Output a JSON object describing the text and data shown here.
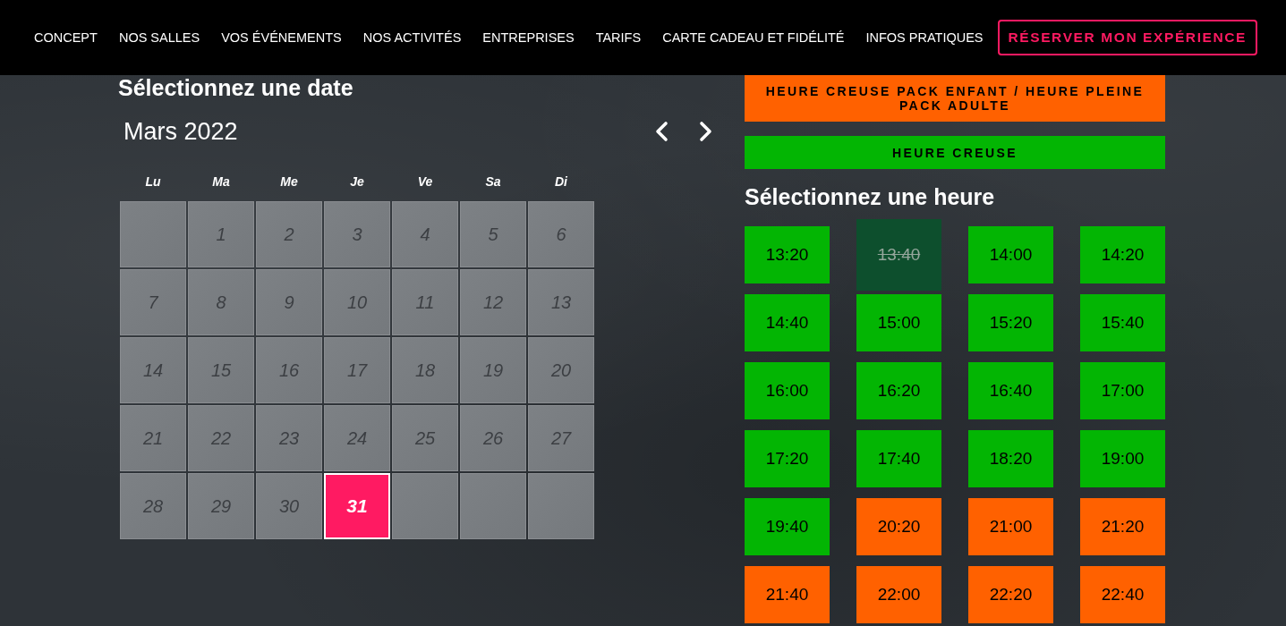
{
  "nav": {
    "links": [
      "CONCEPT",
      "NOS SALLES",
      "VOS ÉVÉNEMENTS",
      "NOS ACTIVITÉS",
      "ENTREPRISES",
      "TARIFS",
      "CARTE CADEAU ET FIDÉLITÉ",
      "INFOS PRATIQUES"
    ],
    "reserve_button": "RÉSERVER MON EXPÉRIENCE"
  },
  "date_picker": {
    "title": "Sélectionnez une date",
    "month": "Mars 2022",
    "weekdays": [
      "Lu",
      "Ma",
      "Me",
      "Je",
      "Ve",
      "Sa",
      "Di"
    ],
    "cells": [
      {
        "kind": "empty"
      },
      {
        "kind": "day",
        "label": "1",
        "disabled": true,
        "selected": false
      },
      {
        "kind": "day",
        "label": "2",
        "disabled": true,
        "selected": false
      },
      {
        "kind": "day",
        "label": "3",
        "disabled": true,
        "selected": false
      },
      {
        "kind": "day",
        "label": "4",
        "disabled": true,
        "selected": false
      },
      {
        "kind": "day",
        "label": "5",
        "disabled": true,
        "selected": false
      },
      {
        "kind": "day",
        "label": "6",
        "disabled": true,
        "selected": false
      },
      {
        "kind": "day",
        "label": "7",
        "disabled": true,
        "selected": false
      },
      {
        "kind": "day",
        "label": "8",
        "disabled": true,
        "selected": false
      },
      {
        "kind": "day",
        "label": "9",
        "disabled": true,
        "selected": false
      },
      {
        "kind": "day",
        "label": "10",
        "disabled": true,
        "selected": false
      },
      {
        "kind": "day",
        "label": "11",
        "disabled": true,
        "selected": false
      },
      {
        "kind": "day",
        "label": "12",
        "disabled": true,
        "selected": false
      },
      {
        "kind": "day",
        "label": "13",
        "disabled": true,
        "selected": false
      },
      {
        "kind": "day",
        "label": "14",
        "disabled": true,
        "selected": false
      },
      {
        "kind": "day",
        "label": "15",
        "disabled": true,
        "selected": false
      },
      {
        "kind": "day",
        "label": "16",
        "disabled": true,
        "selected": false
      },
      {
        "kind": "day",
        "label": "17",
        "disabled": true,
        "selected": false
      },
      {
        "kind": "day",
        "label": "18",
        "disabled": true,
        "selected": false
      },
      {
        "kind": "day",
        "label": "19",
        "disabled": true,
        "selected": false
      },
      {
        "kind": "day",
        "label": "20",
        "disabled": true,
        "selected": false
      },
      {
        "kind": "day",
        "label": "21",
        "disabled": true,
        "selected": false
      },
      {
        "kind": "day",
        "label": "22",
        "disabled": true,
        "selected": false
      },
      {
        "kind": "day",
        "label": "23",
        "disabled": true,
        "selected": false
      },
      {
        "kind": "day",
        "label": "24",
        "disabled": true,
        "selected": false
      },
      {
        "kind": "day",
        "label": "25",
        "disabled": true,
        "selected": false
      },
      {
        "kind": "day",
        "label": "26",
        "disabled": true,
        "selected": false
      },
      {
        "kind": "day",
        "label": "27",
        "disabled": true,
        "selected": false
      },
      {
        "kind": "day",
        "label": "28",
        "disabled": true,
        "selected": false
      },
      {
        "kind": "day",
        "label": "29",
        "disabled": true,
        "selected": false
      },
      {
        "kind": "day",
        "label": "30",
        "disabled": true,
        "selected": false
      },
      {
        "kind": "day",
        "label": "31",
        "disabled": false,
        "selected": true
      },
      {
        "kind": "empty"
      },
      {
        "kind": "empty"
      },
      {
        "kind": "empty"
      }
    ]
  },
  "legend": [
    {
      "label": "HEURE CREUSE PACK ENFANT / HEURE PLEINE PACK ADULTE",
      "color": "#ff6100"
    },
    {
      "label": "HEURE CREUSE",
      "color": "#03b503"
    }
  ],
  "time_picker": {
    "title": "Sélectionnez une heure",
    "slots": [
      {
        "time": "13:20",
        "color": "#03b503",
        "disabled": false
      },
      {
        "time": "13:40",
        "color": "#0d4f2d",
        "disabled": true
      },
      {
        "time": "14:00",
        "color": "#03b503",
        "disabled": false
      },
      {
        "time": "14:20",
        "color": "#03b503",
        "disabled": false
      },
      {
        "time": "14:40",
        "color": "#03b503",
        "disabled": false
      },
      {
        "time": "15:00",
        "color": "#03b503",
        "disabled": false
      },
      {
        "time": "15:20",
        "color": "#03b503",
        "disabled": false
      },
      {
        "time": "15:40",
        "color": "#03b503",
        "disabled": false
      },
      {
        "time": "16:00",
        "color": "#03b503",
        "disabled": false
      },
      {
        "time": "16:20",
        "color": "#03b503",
        "disabled": false
      },
      {
        "time": "16:40",
        "color": "#03b503",
        "disabled": false
      },
      {
        "time": "17:00",
        "color": "#03b503",
        "disabled": false
      },
      {
        "time": "17:20",
        "color": "#03b503",
        "disabled": false
      },
      {
        "time": "17:40",
        "color": "#03b503",
        "disabled": false
      },
      {
        "time": "18:20",
        "color": "#03b503",
        "disabled": false
      },
      {
        "time": "19:00",
        "color": "#03b503",
        "disabled": false
      },
      {
        "time": "19:40",
        "color": "#03b503",
        "disabled": false
      },
      {
        "time": "20:20",
        "color": "#ff6100",
        "disabled": false
      },
      {
        "time": "21:00",
        "color": "#ff6100",
        "disabled": false
      },
      {
        "time": "21:20",
        "color": "#ff6100",
        "disabled": false
      },
      {
        "time": "21:40",
        "color": "#ff6100",
        "disabled": false
      },
      {
        "time": "22:00",
        "color": "#ff6100",
        "disabled": false
      },
      {
        "time": "22:20",
        "color": "#ff6100",
        "disabled": false
      },
      {
        "time": "22:40",
        "color": "#ff6100",
        "disabled": false
      }
    ]
  }
}
